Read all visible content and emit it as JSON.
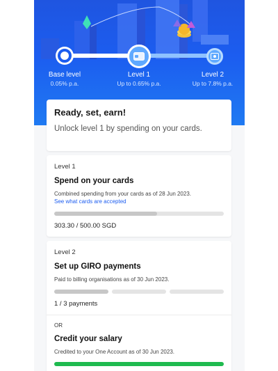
{
  "levels": {
    "base": {
      "name": "Base level",
      "rate": "0.05% p.a."
    },
    "l1": {
      "name": "Level 1",
      "rate": "Up to 0.65% p.a."
    },
    "l2": {
      "name": "Level 2",
      "rate": "Up to 7.8% p.a."
    },
    "progress_fraction": 0.46
  },
  "intro": {
    "title": "Ready, set, earn!",
    "body": "Unlock level 1 by spending on your cards."
  },
  "level1_card": {
    "label": "Level 1",
    "title": "Spend on your cards",
    "desc": "Combined spending from your cards as of 28 Jun 2023.",
    "link": "See what cards are accepted",
    "progress_fraction": 0.607,
    "amount": "303.30 / 500.00 SGD"
  },
  "level2_card": {
    "label": "Level 2",
    "giro_title": "Set up GIRO payments",
    "giro_desc": "Paid to billing organisations as of 30 Jun 2023.",
    "giro_count": "1 / 3 payments",
    "or": "OR",
    "salary_title": "Credit your salary",
    "salary_desc": "Credited to your One Account as of 30 Jun 2023.",
    "salary_progress_fraction": 1.0
  },
  "colors": {
    "brand_blue": "#1c5df0",
    "link_blue": "#1c5df0",
    "success_green": "#1fba4f",
    "track_light": "#8fc2ff"
  },
  "icons": {
    "base_node": "radio-ring-icon",
    "level1_node": "card-icon",
    "level2_node": "salary-icon"
  }
}
